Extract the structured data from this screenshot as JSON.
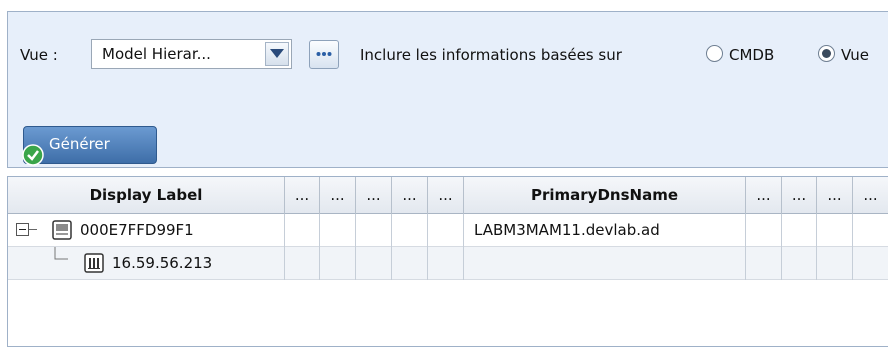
{
  "toolbar": {
    "vue_label": "Vue :",
    "view_select_value": "Model Hierar...",
    "more_button_label": "...",
    "include_label": "Inclure les informations basées sur",
    "radio_cmdb_label": "CMDB",
    "radio_vue_label": "Vue",
    "selected_option": "Vue",
    "generate_button_label": "Générer"
  },
  "table": {
    "columns": [
      "Display Label",
      "...",
      "...",
      "...",
      "...",
      "...",
      "PrimaryDnsName",
      "...",
      "...",
      "...",
      "..."
    ],
    "rows": [
      {
        "display_label": "000E7FFD99F1",
        "primary_dns_name": "LABM3MAM11.devlab.ad",
        "icon": "computer-node-icon",
        "expanded": true
      },
      {
        "display_label": "16.59.56.213",
        "primary_dns_name": "",
        "icon": "ip-address-icon"
      }
    ]
  }
}
